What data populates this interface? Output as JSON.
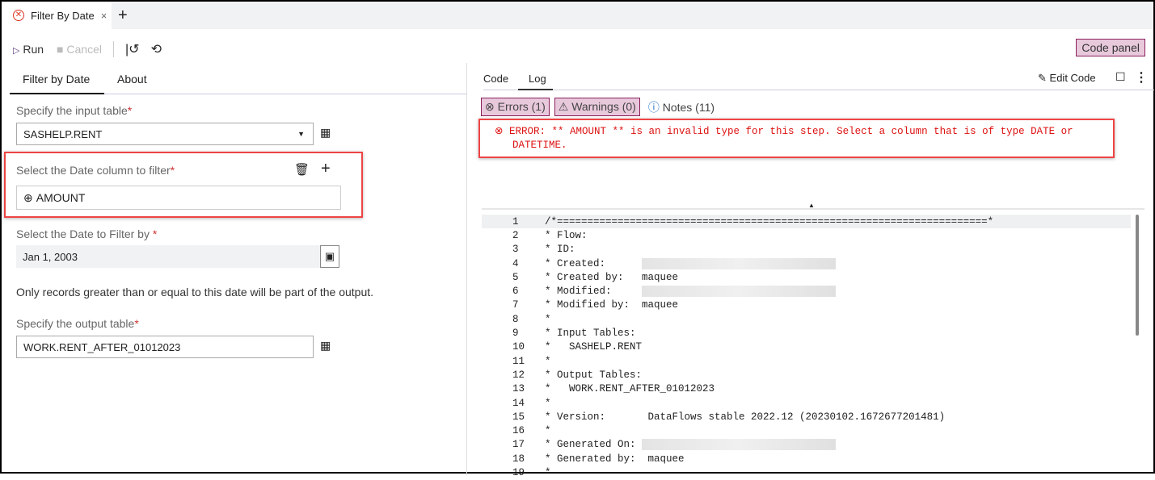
{
  "tab": {
    "title": "Filter By Date",
    "close": "×",
    "new": "+"
  },
  "toolbar": {
    "run": "Run",
    "cancel": "Cancel",
    "code_panel": "Code panel"
  },
  "left": {
    "tabs": [
      "Filter by Date",
      "About"
    ],
    "input_label": "Specify the input table",
    "input_value": "SASHELP.RENT",
    "date_col_label": "Select the Date column to filter",
    "date_col_value": "AMOUNT",
    "date_label": "Select the Date to Filter by",
    "date_value": "Jan 1, 2003",
    "hint": "Only records greater than or equal to this date will be part of the output.",
    "output_label": "Specify the output table",
    "output_value": "WORK.RENT_AFTER_01012023",
    "required": "*"
  },
  "right": {
    "tabs": [
      "Code",
      "Log"
    ],
    "edit_code": "Edit Code",
    "errors": "Errors (1)",
    "warnings": "Warnings (0)",
    "notes": "Notes (11)",
    "error_line1": "ERROR: ** AMOUNT ** is an invalid type for this step.  Select a column that is of type DATE or",
    "error_line2": "DATETIME.",
    "code_lines": [
      "/*=======================================================================*",
      "* Flow:",
      "* ID:",
      "* Created:      ",
      "* Created by:   maquee",
      "* Modified:     ",
      "* Modified by:  maquee",
      "*",
      "* Input Tables:",
      "*   SASHELP.RENT",
      "*",
      "* Output Tables:",
      "*   WORK.RENT_AFTER_01012023",
      "*",
      "* Version:       DataFlows stable 2022.12 (20230102.1672677201481)",
      "*",
      "* Generated On: ",
      "* Generated by:  maquee",
      "*"
    ]
  }
}
